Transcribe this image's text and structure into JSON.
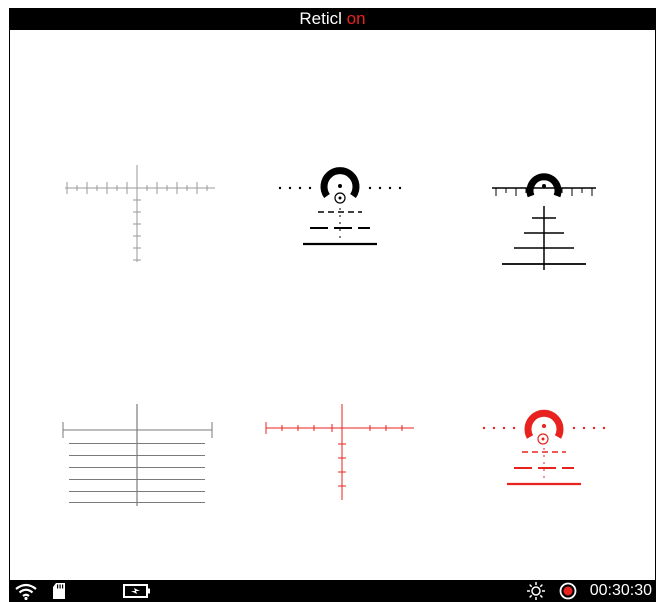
{
  "header": {
    "title_prefix": "Reticl",
    "title_state": "on"
  },
  "reticles": [
    {
      "id": "reticle-1",
      "color": "#9a9a9a"
    },
    {
      "id": "reticle-2",
      "color": "#000000"
    },
    {
      "id": "reticle-3",
      "color": "#000000"
    },
    {
      "id": "reticle-4",
      "color": "#7a7a7a"
    },
    {
      "id": "reticle-5",
      "color": "#e8231f"
    },
    {
      "id": "reticle-6",
      "color": "#e8231f"
    }
  ],
  "status_bar": {
    "icons": [
      "wifi-icon",
      "sd-card-icon",
      "battery-icon",
      "brightness-icon",
      "record-icon"
    ],
    "timer": "00:30:30",
    "record_color": "#e8231f"
  }
}
